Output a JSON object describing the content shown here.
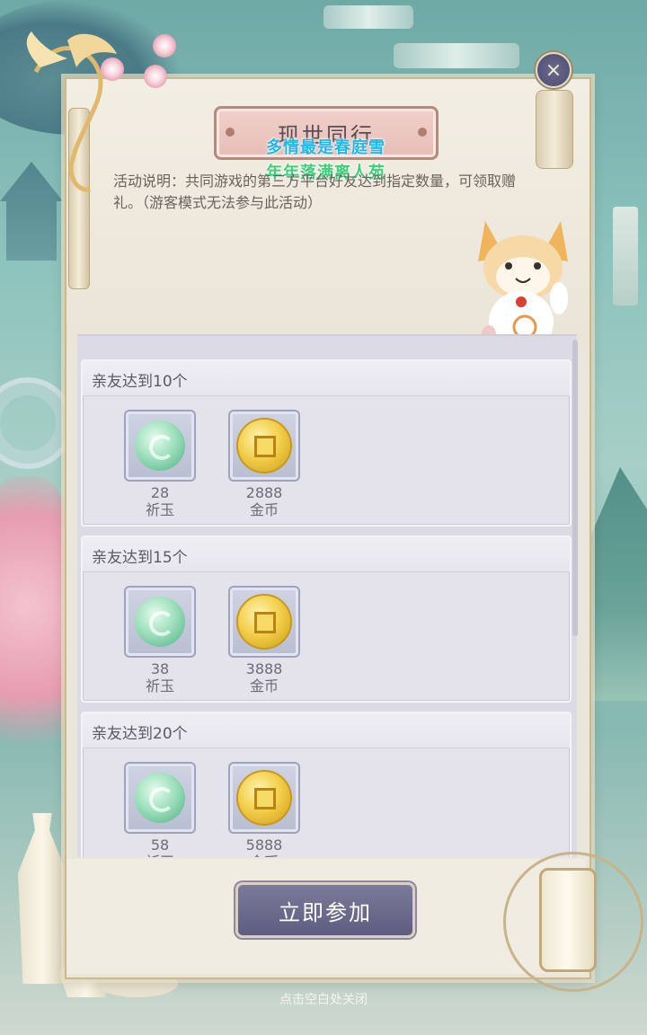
{
  "title": "现世同行",
  "overlay_lines": [
    {
      "text": "多情最是春庭雪",
      "color": "#22b7e8"
    },
    {
      "text": "年年落满离人苑",
      "color": "#3fcf7a"
    }
  ],
  "description": "活动说明：共同游戏的第三方平台好友达到指定数量，可领取赠礼。（游客模式无法参与此活动）",
  "close_icon": "×",
  "tiers": [
    {
      "title": "亲友达到10个",
      "rewards": [
        {
          "icon": "jade-icon",
          "count": "28",
          "name": "祈玉"
        },
        {
          "icon": "gold-coin-icon",
          "count": "2888",
          "name": "金币"
        }
      ]
    },
    {
      "title": "亲友达到15个",
      "rewards": [
        {
          "icon": "jade-icon",
          "count": "38",
          "name": "祈玉"
        },
        {
          "icon": "gold-coin-icon",
          "count": "3888",
          "name": "金币"
        }
      ]
    },
    {
      "title": "亲友达到20个",
      "rewards": [
        {
          "icon": "jade-icon",
          "count": "58",
          "name": "祈玉"
        },
        {
          "icon": "gold-coin-icon",
          "count": "5888",
          "name": "金币"
        }
      ]
    }
  ],
  "join_button": "立即参加",
  "footer_hint": "点击空白处关闭"
}
